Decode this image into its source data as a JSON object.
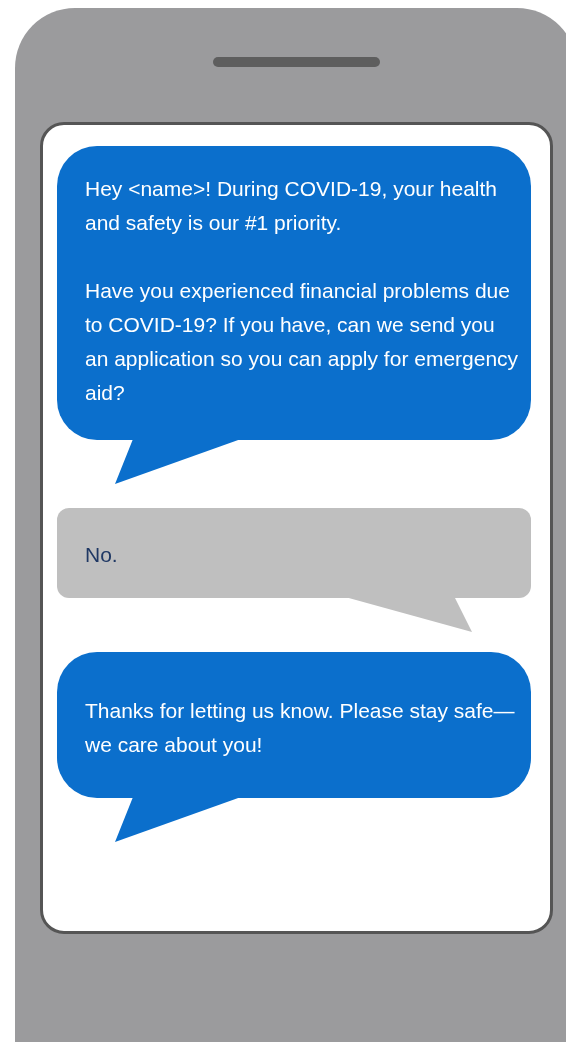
{
  "messages": [
    {
      "kind": "sent",
      "paragraphs": [
        "Hey <name>! During COVID-19, your health and safety is our #1 priority.",
        "Have you experienced financial problems due to COVID-19? If you have, can we send you an application so you can apply for emergency aid?"
      ]
    },
    {
      "kind": "received",
      "paragraphs": [
        "No."
      ]
    },
    {
      "kind": "sent",
      "paragraphs": [
        "Thanks for letting us know. Please stay safe—we care about you!"
      ]
    }
  ]
}
